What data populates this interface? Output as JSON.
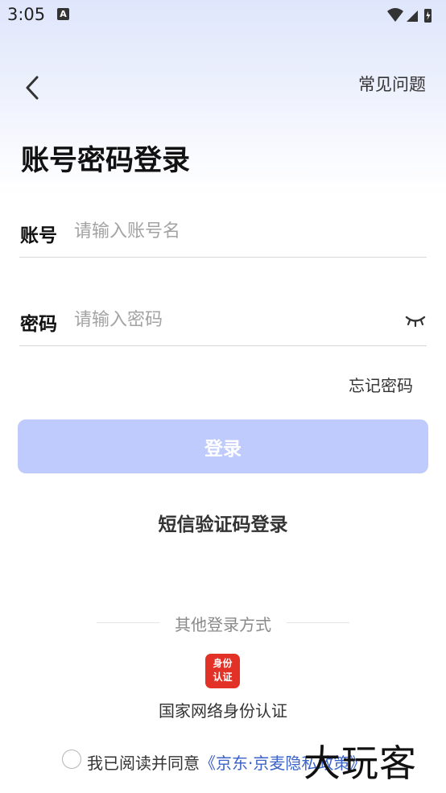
{
  "status_bar": {
    "time": "3:05",
    "notification_icon": "A"
  },
  "header": {
    "back_icon": "chevron-left-icon",
    "faq_label": "常见问题"
  },
  "title": "账号密码登录",
  "account_field": {
    "label": "账号",
    "placeholder": "请输入账号名",
    "value": ""
  },
  "password_field": {
    "label": "密码",
    "placeholder": "请输入密码",
    "value": "",
    "toggle_icon": "eye-closed-icon"
  },
  "forgot_label": "忘记密码",
  "login_button_label": "登录",
  "sms_login_label": "短信验证码登录",
  "other_login": {
    "label": "其他登录方式",
    "id_auth": {
      "icon_text": "身份认证",
      "label": "国家网络身份认证"
    }
  },
  "agreement": {
    "prefix": "我已阅读并同意",
    "link": "《京东·京麦隐私政策》",
    "checked": false
  },
  "watermark": "大玩客",
  "colors": {
    "login_button": "#bfcbfd",
    "link": "#3a62c8",
    "id_auth": "#e23127"
  }
}
